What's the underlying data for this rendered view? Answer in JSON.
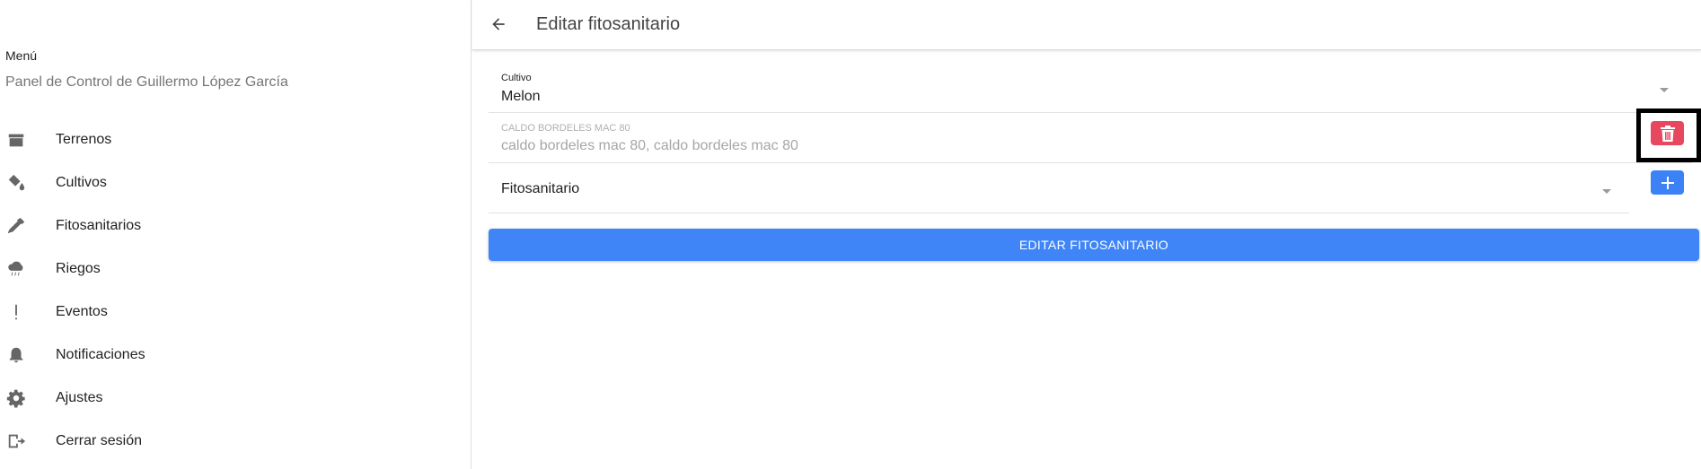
{
  "sidebar": {
    "menu_title": "Menú",
    "subtitle": "Panel de Control de Guillermo López García",
    "items": [
      {
        "label": "Terrenos",
        "icon": "box-icon"
      },
      {
        "label": "Cultivos",
        "icon": "paint-bucket-icon"
      },
      {
        "label": "Fitosanitarios",
        "icon": "eyedropper-icon"
      },
      {
        "label": "Riegos",
        "icon": "rain-cloud-icon"
      },
      {
        "label": "Eventos",
        "icon": "exclamation-icon"
      },
      {
        "label": "Notificaciones",
        "icon": "bell-icon"
      },
      {
        "label": "Ajustes",
        "icon": "gear-icon"
      },
      {
        "label": "Cerrar sesión",
        "icon": "logout-icon"
      }
    ]
  },
  "header": {
    "title": "Editar fitosanitario"
  },
  "form": {
    "cultivo": {
      "label": "Cultivo",
      "value": "Melon"
    },
    "caldo": {
      "label": "CALDO BORDELES MAC 80",
      "value": "caldo bordeles mac 80, caldo bordeles mac 80"
    },
    "fitosanitario": {
      "value": "Fitosanitario"
    },
    "submit_label": "EDITAR FITOSANITARIO"
  },
  "colors": {
    "primary": "#3f85f7",
    "danger": "#e8485f",
    "icon_gray": "#666666"
  }
}
